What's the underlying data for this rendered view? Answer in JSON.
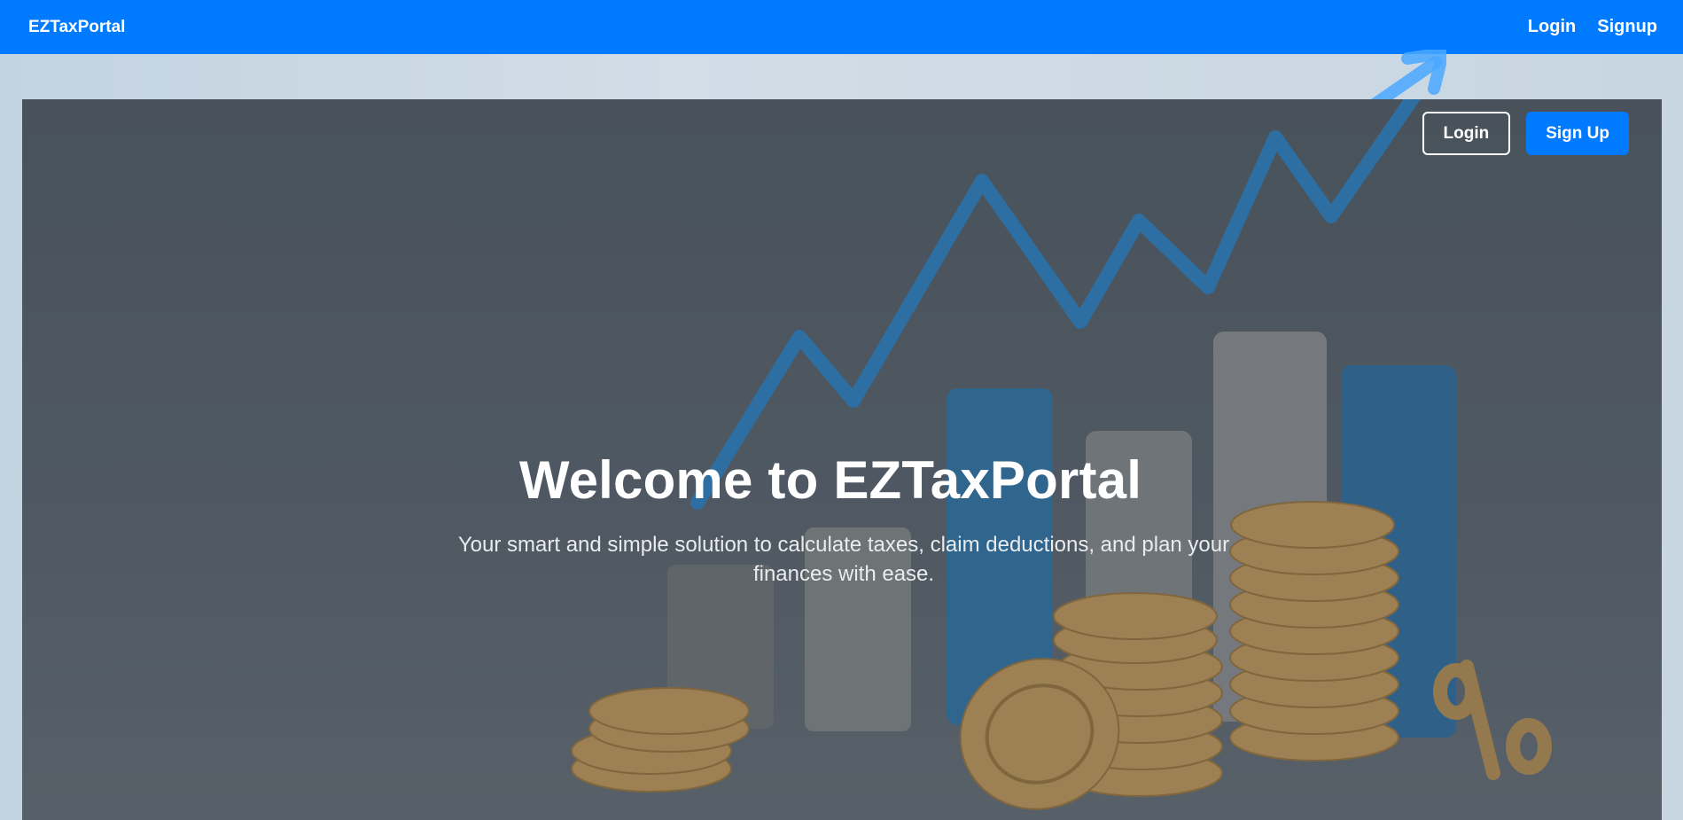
{
  "navbar": {
    "brand": "EZTaxPortal",
    "links": [
      {
        "label": "Login"
      },
      {
        "label": "Signup"
      }
    ]
  },
  "hero": {
    "actions": {
      "login_label": "Login",
      "signup_label": "Sign Up"
    },
    "title": "Welcome to EZTaxPortal",
    "subtitle": "Your smart and simple solution to calculate taxes, claim deductions, and plan your finances with ease.",
    "background_image": "growth-chart-coins-illustration"
  },
  "colors": {
    "primary": "#007bff",
    "hero_bg": "#525c66",
    "coin_gold": "#b8955e",
    "chart_blue": "#2e78b5"
  }
}
